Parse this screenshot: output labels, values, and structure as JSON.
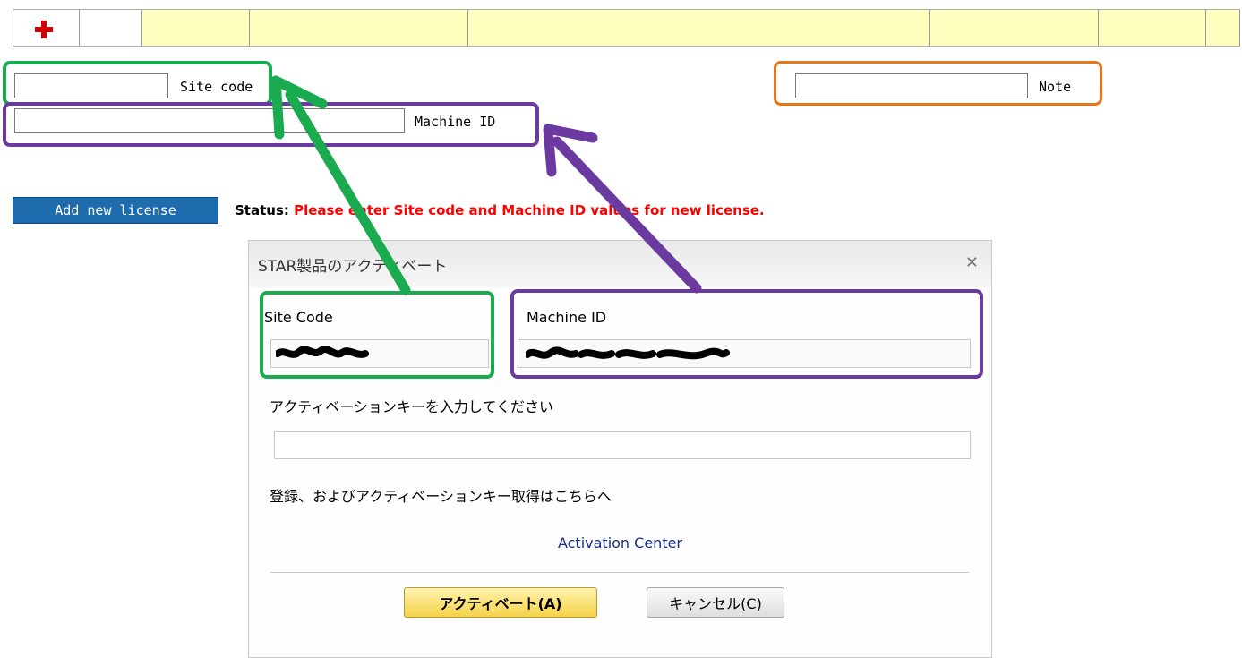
{
  "top_row": {
    "add_icon": "red-plus-icon"
  },
  "form": {
    "site_code_label": "Site code",
    "machine_id_label": "Machine ID",
    "note_label": "Note",
    "site_code_value": "",
    "machine_id_value": "",
    "note_value": ""
  },
  "action": {
    "add_button": "Add new license",
    "status_key": "Status:",
    "status_value": "Please enter Site code and Machine ID values for new license."
  },
  "dialog": {
    "title": "STAR製品のアクティベート",
    "close_icon": "close-x-icon",
    "site_code_label": "Site Code",
    "machine_id_label": "Machine ID",
    "activation_prompt": "アクティベーションキーを入力してください",
    "activation_key_value": "",
    "register_text": "登録、およびアクティベーションキー取得はこちらへ",
    "activation_center_link": "Activation Center",
    "activate_button": "アクティベート(A)",
    "cancel_button": "キャンセル(C)"
  },
  "colors": {
    "green": "#1aaa4f",
    "purple": "#6b3aa0",
    "orange": "#e6761c",
    "status_red": "#ff0000",
    "button_blue": "#1e6bae"
  }
}
